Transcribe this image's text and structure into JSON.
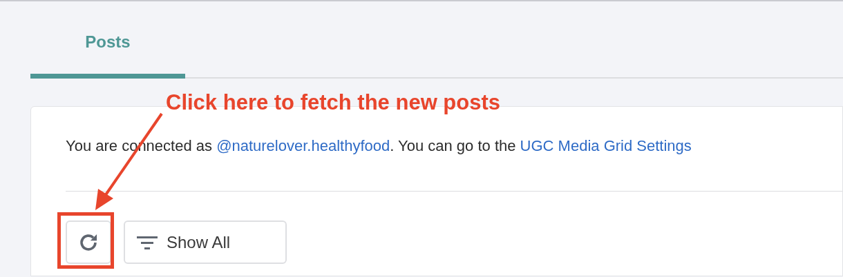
{
  "tabs": [
    {
      "label": "Posts",
      "selected": true
    }
  ],
  "annotation": {
    "text": "Click here to fetch the new posts"
  },
  "connection": {
    "parts": [
      {
        "kind": "text",
        "text": "You are connected as "
      },
      {
        "kind": "link",
        "text": "@naturelover.healthyfood"
      },
      {
        "kind": "text",
        "text": ". You can go to the "
      },
      {
        "kind": "link",
        "text": "UGC Media Grid Settings"
      }
    ]
  },
  "toolbar": {
    "refresh_highlighted": true,
    "filter": {
      "label": "Show All"
    }
  }
}
